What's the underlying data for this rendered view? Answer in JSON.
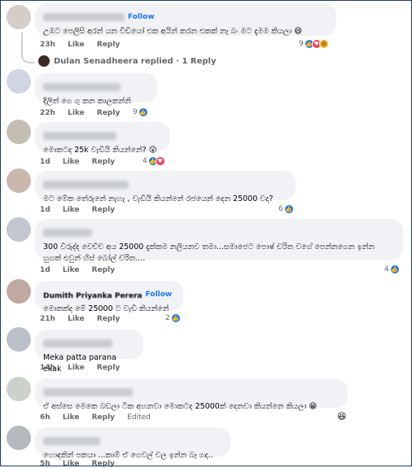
{
  "comments": [
    {
      "follow": "Follow",
      "text": "උඹට පෙලිසි අරන් යන වීඩියෝ එක අයින් කරන එකක් නෑ බං මට දැමම කියලා",
      "emoji": "😄",
      "time": "23h",
      "like": "Like",
      "reply": "Reply",
      "count": "9"
    },
    {
      "text": "දිලිත් ගෙ ගු කන කාලකන්නි",
      "time": "22h",
      "like": "Like",
      "reply": "Reply",
      "count": "9"
    },
    {
      "text": "මොකටද 25k වැඩියි කියන්නේ?",
      "emoji": "😲",
      "time": "1d",
      "like": "Like",
      "reply": "Reply",
      "count": "4"
    },
    {
      "text": "මට මේක තේරුනේ නැහැ , වැඩියි කියන්නේ රජයෙන් දෙන 25000 වද?",
      "time": "1d",
      "like": "Like",
      "reply": "Reply",
      "count": "6"
    },
    {
      "text": "300 විරුද්ද වෙච්ච අය 25000 දැක්කම නලියනව තමා...සමාජෙට පොෂ් චරිත වගේ පෙන්නගෙන ඉන්න හුගක් එවුන් හිස් බෝල් චරිත....",
      "time": "1d",
      "like": "Like",
      "reply": "Reply",
      "count": "4"
    },
    {
      "name": "Dumith Priyanka Perera",
      "follow": "Follow",
      "text": "මොකක්ද මේ 25000 ට වැඩි කියන්නේ",
      "time": "21h",
      "like": "Like",
      "reply": "Reply",
      "count": "2"
    },
    {
      "text": "Meka patta parana ekak",
      "time": "14h",
      "like": "Like",
      "reply": "Reply"
    },
    {
      "text": "ඒ අස්සෙ මෙකෙ බඩලා ටික අහනවා මොකටද 25000ක් දෙනවා කියන්නෙ කියලා",
      "emoji": "😁",
      "time": "6h",
      "like": "Like",
      "reply": "Reply",
      "edited": "Edited"
    },
    {
      "text": "හොඳකින් පකයා ...කාම් ඒ ගෙවල් වල ඉන්න බෑ ගද..",
      "time": "5h",
      "like": "Like",
      "reply": "Reply"
    }
  ],
  "reply_line": "Dulan Senadheera replied · 1 Reply",
  "icons": {
    "like": "👍",
    "love": "♥",
    "haha": "😆"
  },
  "colors": {
    "bubble": "#f0f2f5",
    "link": "#1877f2",
    "meta": "#65676b",
    "frame": "#1c3f66"
  }
}
